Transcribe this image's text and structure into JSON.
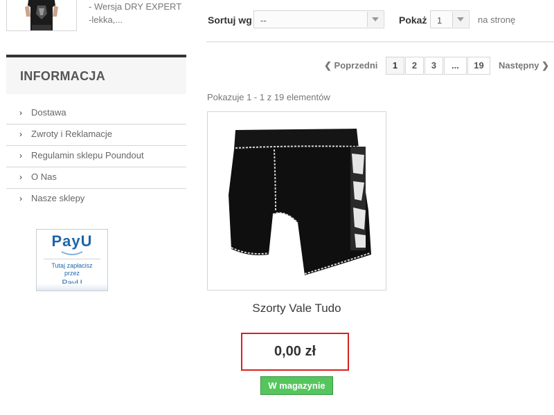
{
  "promo": {
    "image_alt": "black sleeveless fight shirt",
    "desc_line1": "- Wersja DRY EXPERT",
    "desc_line2": "-lekka,..."
  },
  "toolbar": {
    "sort_label": "Sortuj wg",
    "sort_value": "--",
    "show_label": "Pokaż",
    "show_value": "1",
    "per_page": "na stronę"
  },
  "pagination": {
    "prev": "Poprzedni",
    "next": "Następny",
    "pages": [
      "1",
      "2",
      "3",
      "...",
      "19"
    ],
    "current": "1"
  },
  "listing": {
    "count_text": "Pokazuje 1 - 1 z 19 elementów"
  },
  "product": {
    "name": "Szorty Vale Tudo",
    "price": "0,00 zł",
    "availability": "W magazynie"
  },
  "sidebar": {
    "title": "INFORMACJA",
    "items": [
      {
        "label": "Dostawa"
      },
      {
        "label": "Zwroty i Reklamacje"
      },
      {
        "label": "Regulamin sklepu Poundout"
      },
      {
        "label": "O Nas"
      },
      {
        "label": "Nasze sklepy"
      }
    ]
  },
  "payu_badge": {
    "logo_text": "PayU",
    "line1": "Tutaj zapłacisz",
    "line2": "przez",
    "line3": "PayU"
  },
  "colors": {
    "price_border": "#d9201d",
    "stock_bg": "#55c65e",
    "payu_blue": "#1e66a8"
  }
}
